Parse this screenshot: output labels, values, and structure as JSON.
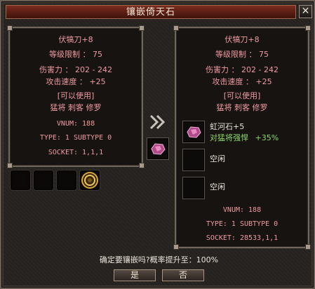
{
  "window": {
    "title": "镶嵌倚天石"
  },
  "left_item": {
    "name": "伏犒刀+8",
    "level_req": "等级限制 ： 75",
    "damage": "伤害力 ： 202 - 242",
    "attack_speed": "攻击速度 ： +25",
    "usable": "[可以使用]",
    "classes": "猛将 刺客 修罗",
    "vnum": "VNUM: 188",
    "type": "TYPE: 1 SUBTYPE 0",
    "socket": "SOCKET: 1,1,1"
  },
  "right_item": {
    "name": "伏犒刀+8",
    "level_req": "等级限制 ： 75",
    "damage": "伤害力 ： 202 - 242",
    "attack_speed": "攻击速度 ： +25",
    "usable": "[可以使用]",
    "classes": "猛将 刺客 修罗",
    "vnum": "VNUM: 188",
    "type": "TYPE: 1 SUBTYPE 0",
    "socket": "SOCKET: 28533,1,1"
  },
  "sockets": [
    {
      "name": "虹河石+5",
      "bonus": "对猛将强悍",
      "bonus_value": "+35%",
      "icon": "gem-icon"
    },
    {
      "name": "空闲",
      "icon": "empty-slot"
    },
    {
      "name": "空闲",
      "icon": "empty-slot"
    }
  ],
  "arrow_icon": "double-chevron-right-icon",
  "confirm_text": "确定要镶嵌吗?概率提升至：100%",
  "buttons": {
    "yes": "是",
    "no": "否"
  },
  "colors": {
    "stat_text": "#f09aa0",
    "bonus_text": "#8fd86b",
    "title_bar": "#6a2418"
  }
}
